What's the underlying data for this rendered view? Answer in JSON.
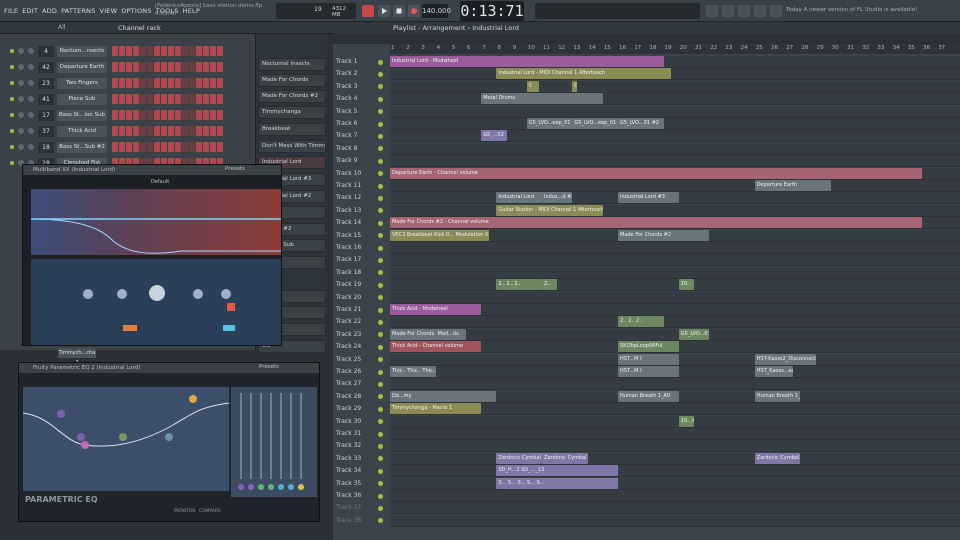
{
  "menu": [
    "FILE",
    "EDIT",
    "ADD",
    "PATTERNS",
    "VIEW",
    "OPTIONS",
    "TOOLS",
    "HELP"
  ],
  "project": {
    "file": "[FedericoApexla] bass station demo.flp",
    "position": "4:03:40"
  },
  "transport": {
    "time": "0:13:71",
    "tempo": "140.000",
    "pattern_num": "19",
    "mem": "4312 MB"
  },
  "hint": "Today  A newer version of FL Studio is available!",
  "rack": {
    "title": "Channel rack",
    "filter": "All",
    "channels": [
      {
        "num": "4",
        "name": "Noctum...nsects"
      },
      {
        "num": "42",
        "name": "Departure Earth"
      },
      {
        "num": "23",
        "name": "Two Fingers"
      },
      {
        "num": "41",
        "name": "Piece Sub"
      },
      {
        "num": "17",
        "name": "Bass St...ion Sub"
      },
      {
        "num": "37",
        "name": "Thick Acid"
      },
      {
        "num": "18",
        "name": "Bass St...Sub #2"
      },
      {
        "num": "28",
        "name": "Clenched Fist"
      }
    ],
    "lower_num": "Timmych...cha 2"
  },
  "browser": {
    "items": [
      "Nocturnal Insects",
      "Made For Chords",
      "Made For Chords #2",
      "Timmychanga",
      "Breakbeat",
      "Don't Mess With Timmy",
      "Industrial Lord",
      "Industrial Lord #3",
      "Industrial Lord #2",
      "Station",
      "Station #2",
      "Station Sub",
      "ed Fist",
      "ingers",
      "rums",
      "ee",
      "cid"
    ]
  },
  "multiband": {
    "title": "Multiband XX (Industrial Lord)",
    "presets": "Presets",
    "preset_name": "Default"
  },
  "eq": {
    "title": "Fruity Parametric EQ 2 (Industrial Lord)",
    "presets": "Presets",
    "logo": "PARAMETRIC EQ",
    "monitor": "MONITOR",
    "compare": "COMPARE"
  },
  "playlist": {
    "title": "Playlist - Arrangement › Industrial Lord",
    "bars": [
      "1",
      "2",
      "3",
      "4",
      "5",
      "6",
      "7",
      "8",
      "9",
      "10",
      "11",
      "12",
      "13",
      "14",
      "15",
      "16",
      "17",
      "18",
      "19",
      "20",
      "21",
      "22",
      "23",
      "24",
      "25",
      "26",
      "27",
      "28",
      "29",
      "30",
      "31",
      "32",
      "33",
      "34",
      "35",
      "36",
      "37"
    ],
    "tracks": [
      "Track 1",
      "Track 2",
      "Track 3",
      "Track 4",
      "Track 5",
      "Track 6",
      "Track 7",
      "Track 8",
      "Track 9",
      "Track 10",
      "Track 11",
      "Track 12",
      "Track 13",
      "Track 14",
      "Track 15",
      "Track 16",
      "Track 17",
      "Track 18",
      "Track 19",
      "Track 20",
      "Track 21",
      "Track 22",
      "Track 23",
      "Track 24",
      "Track 25",
      "Track 26",
      "Track 27",
      "Track 28",
      "Track 29",
      "Track 30",
      "Track 31",
      "Track 32",
      "Track 33",
      "Track 34",
      "Track 35",
      "Track 36",
      "Track 37",
      "Track 38"
    ],
    "clips": [
      {
        "track": 0,
        "start": 1,
        "len": 18,
        "color": "purple",
        "label": "Industrial Lord - Modwheel"
      },
      {
        "track": 1,
        "start": 8,
        "len": 11.5,
        "color": "olive",
        "label": "Industrial Lord - MIDI Channel 1 Aftertouch"
      },
      {
        "track": 2,
        "start": 10,
        "len": 0.8,
        "color": "olive",
        "label": "C"
      },
      {
        "track": 2,
        "start": 13,
        "len": 0.3,
        "color": "olive",
        "label": "C"
      },
      {
        "track": 3,
        "start": 7,
        "len": 8,
        "color": "grey",
        "label": "Metal Drums"
      },
      {
        "track": 5,
        "start": 10,
        "len": 3,
        "color": "grey",
        "label": "G5_LVO...eep_01"
      },
      {
        "track": 5,
        "start": 13,
        "len": 3,
        "color": "grey",
        "label": "G5_LVO...eep_01"
      },
      {
        "track": 5,
        "start": 16,
        "len": 3,
        "color": "grey",
        "label": "G5_LVO...01 #2"
      },
      {
        "track": 6,
        "start": 7,
        "len": 1.7,
        "color": "lav",
        "label": "G5_...02"
      },
      {
        "track": 9,
        "start": 1,
        "len": 35,
        "color": "rose",
        "label": "Departure Earth - Channel volume"
      },
      {
        "track": 10,
        "start": 25,
        "len": 5,
        "color": "grey",
        "label": "Departure Earth"
      },
      {
        "track": 11,
        "start": 8,
        "len": 3,
        "color": "grey",
        "label": "Industrial Lord"
      },
      {
        "track": 11,
        "start": 11,
        "len": 2,
        "color": "grey",
        "label": "Indus...d #2"
      },
      {
        "track": 11,
        "start": 16,
        "len": 4,
        "color": "grey",
        "label": "Industrial Lord #3"
      },
      {
        "track": 12,
        "start": 8,
        "len": 7,
        "color": "olive",
        "label": "Guitar Station - MIDI Channel 1 Aftertouch"
      },
      {
        "track": 13,
        "start": 1,
        "len": 35,
        "color": "rose",
        "label": "Made For Chords #2 - Channel volume"
      },
      {
        "track": 14,
        "start": 1,
        "len": 6.5,
        "color": "olive",
        "label": "VEC3 Breakbeat Kick 0... Modulation X offset"
      },
      {
        "track": 14,
        "start": 16,
        "len": 6,
        "color": "grey",
        "label": "Made For Chords #2"
      },
      {
        "track": 18,
        "start": 8,
        "len": 3,
        "color": "green",
        "label": "2.. 2.. 2.."
      },
      {
        "track": 18,
        "start": 11,
        "len": 1,
        "color": "green",
        "label": "2.."
      },
      {
        "track": 18,
        "start": 20,
        "len": 1,
        "color": "green",
        "label": "20.."
      },
      {
        "track": 20,
        "start": 1,
        "len": 6,
        "color": "purple",
        "label": "Thick Acid - Modwheel"
      },
      {
        "track": 21,
        "start": 16,
        "len": 3,
        "color": "green",
        "label": "2.. 2.. 2.."
      },
      {
        "track": 22,
        "start": 1,
        "len": 3,
        "color": "grey",
        "label": "Made For Chords"
      },
      {
        "track": 22,
        "start": 4,
        "len": 2,
        "color": "grey",
        "label": "Mad...ds"
      },
      {
        "track": 22,
        "start": 20,
        "len": 2,
        "color": "green",
        "label": "G5_LVO...01 #2"
      },
      {
        "track": 23,
        "start": 1,
        "len": 6,
        "color": "red",
        "label": "Thick Acid - Channel volume"
      },
      {
        "track": 23,
        "start": 16,
        "len": 4,
        "color": "green",
        "label": "SKLTopLoop06Ful"
      },
      {
        "track": 24,
        "start": 16,
        "len": 4,
        "color": "grey",
        "label": "HST...M I"
      },
      {
        "track": 24,
        "start": 25,
        "len": 4,
        "color": "grey",
        "label": "HST-Kaoss2_Disconnect"
      },
      {
        "track": 25,
        "start": 1,
        "len": 1,
        "color": "grey",
        "label": "Thic...cid"
      },
      {
        "track": 25,
        "start": 2,
        "len": 1,
        "color": "grey",
        "label": "Thic...cid"
      },
      {
        "track": 25,
        "start": 3,
        "len": 1,
        "color": "grey",
        "label": "Thic...cid"
      },
      {
        "track": 25,
        "start": 16,
        "len": 4,
        "color": "grey",
        "label": "HST...M I"
      },
      {
        "track": 25,
        "start": 25,
        "len": 2.5,
        "color": "grey",
        "label": "HST_Kaoss...es_Katana"
      },
      {
        "track": 27,
        "start": 1,
        "len": 7,
        "color": "grey",
        "label": "Do...my"
      },
      {
        "track": 27,
        "start": 16,
        "len": 4,
        "color": "grey",
        "label": "Human Breath 1_A0"
      },
      {
        "track": 27,
        "start": 25,
        "len": 3,
        "color": "grey",
        "label": "Human Breath 1_A0"
      },
      {
        "track": 28,
        "start": 1,
        "len": 6,
        "color": "olive",
        "label": "Timmychanga - Macro 1"
      },
      {
        "track": 29,
        "start": 20,
        "len": 1,
        "color": "green",
        "label": "20...4"
      },
      {
        "track": 32,
        "start": 8,
        "len": 3,
        "color": "lav",
        "label": "Zardonic Cymbal (A)"
      },
      {
        "track": 32,
        "start": 11,
        "len": 3,
        "color": "lav",
        "label": "Zardonic Cymbal (A)"
      },
      {
        "track": 32,
        "start": 25,
        "len": 3,
        "color": "lav",
        "label": "Zardonic Cymbal (A)"
      },
      {
        "track": 33,
        "start": 8,
        "len": 8,
        "color": "lav",
        "label": "SD_H...2 SD_..._13"
      },
      {
        "track": 34,
        "start": 8,
        "len": 8,
        "color": "lav",
        "label": "S... S... S... S... S..."
      }
    ]
  }
}
